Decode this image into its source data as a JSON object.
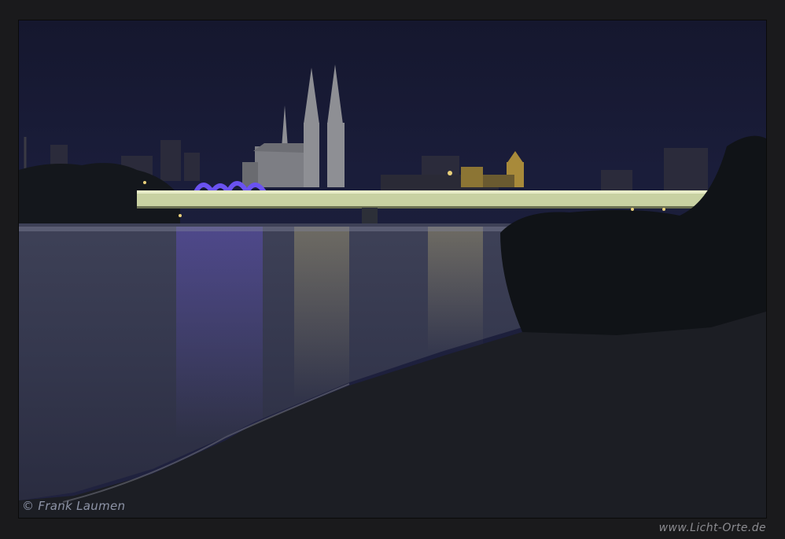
{
  "photo": {
    "copyright_text": "© Frank Laumen",
    "website_text": "www.Licht-Orte.de"
  },
  "colors": {
    "frame": "#1a1a1c",
    "sky": "#1a1d3a",
    "bridge_light": "#cfd7a8",
    "river": "#3a3f5a",
    "accent_violet": "#5b3cf0"
  }
}
